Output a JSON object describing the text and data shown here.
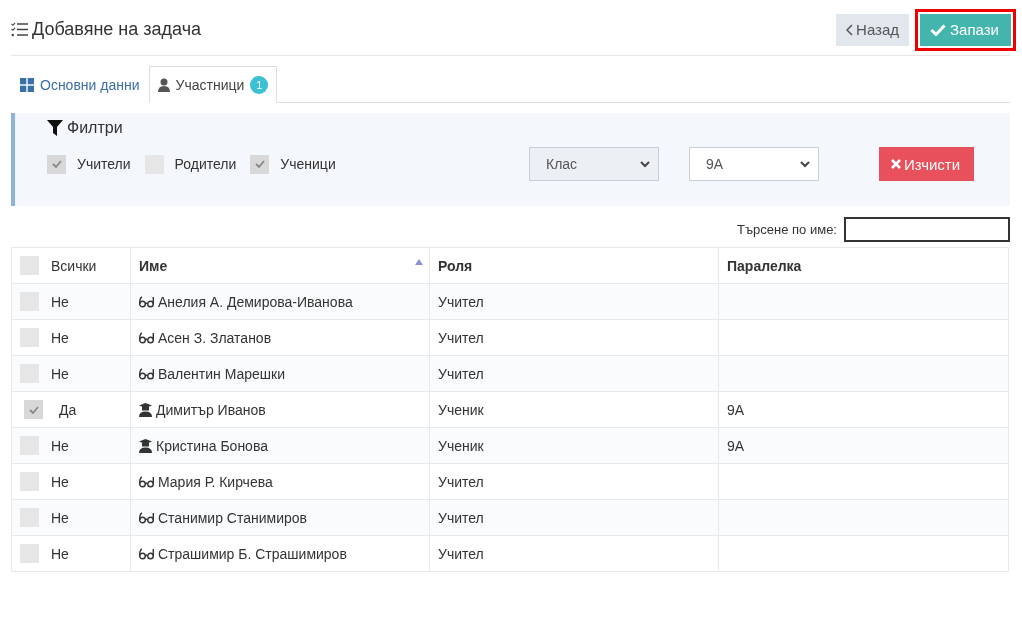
{
  "header": {
    "title": "Добавяне на задача",
    "back_button": "Назад",
    "save_button": "Запази",
    "save_highlighted": true
  },
  "tabs": [
    {
      "label": "Основни данни",
      "selected": false
    },
    {
      "label": "Участници",
      "badge": "1",
      "selected": true
    }
  ],
  "filters": {
    "title": "Филтри",
    "checkboxes": [
      {
        "label": "Учители",
        "checked": true
      },
      {
        "label": "Родители",
        "checked": false
      },
      {
        "label": "Ученици",
        "checked": true
      }
    ],
    "selects": [
      {
        "value": "Клас",
        "disabled": true
      },
      {
        "value": "9А",
        "disabled": false
      }
    ],
    "clear_button": "Изчисти"
  },
  "search": {
    "label": "Търсене по име:"
  },
  "table": {
    "columns": [
      {
        "label": "Всички",
        "kind": "checkbox",
        "checked": false
      },
      {
        "label": "Име",
        "kind": "sorted"
      },
      {
        "label": "Роля",
        "kind": "plain"
      },
      {
        "label": "Паралелка",
        "kind": "plain"
      }
    ],
    "rows": [
      {
        "selected": false,
        "answer": "Не",
        "name": "Анелия А. Демирова-Иванова",
        "kind": "teacher",
        "role": "Учител",
        "class": ""
      },
      {
        "selected": false,
        "answer": "Не",
        "name": "Асен З. Златанов",
        "kind": "teacher",
        "role": "Учител",
        "class": ""
      },
      {
        "selected": false,
        "answer": "Не",
        "name": "Валентин Марешки",
        "kind": "teacher",
        "role": "Учител",
        "class": ""
      },
      {
        "selected": true,
        "answer": "Да",
        "name": "Димитър Иванов",
        "kind": "student",
        "role": "Ученик",
        "class": "9А"
      },
      {
        "selected": false,
        "answer": "Не",
        "name": "Кристина Бонова",
        "kind": "student",
        "role": "Ученик",
        "class": "9А"
      },
      {
        "selected": false,
        "answer": "Не",
        "name": "Мария Р. Кирчева",
        "kind": "teacher",
        "role": "Учител",
        "class": ""
      },
      {
        "selected": false,
        "answer": "Не",
        "name": "Станимир Станимиров",
        "kind": "teacher",
        "role": "Учител",
        "class": ""
      },
      {
        "selected": false,
        "answer": "Не",
        "name": "Страшимир Б. Страшимиров",
        "kind": "teacher",
        "role": "Учител",
        "class": ""
      }
    ]
  }
}
